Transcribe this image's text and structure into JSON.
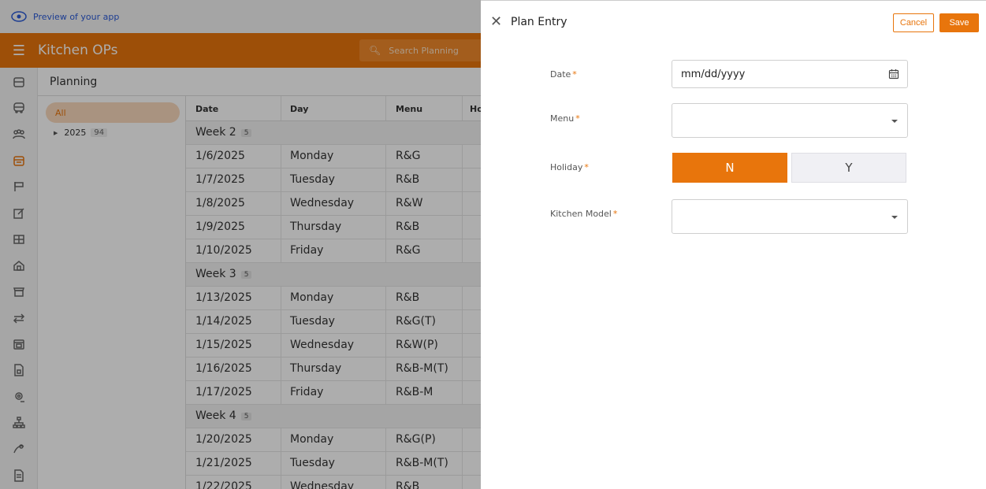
{
  "preview": {
    "text": "Preview of your app"
  },
  "header": {
    "title": "Kitchen OPs",
    "search_placeholder": "Search Planning"
  },
  "rail": {
    "icons": [
      "building-icon",
      "bus-icon",
      "users-icon",
      "calendar-icon",
      "sign-icon",
      "edit-icon",
      "table-icon",
      "home-icon",
      "store-icon",
      "transfer-icon",
      "calendar-alt-icon",
      "document-icon",
      "location-icon",
      "org-chart-icon",
      "settings-icon",
      "file-icon"
    ]
  },
  "page": {
    "title": "Planning"
  },
  "tree": {
    "all_label": "All",
    "year": "2025",
    "year_count": "94"
  },
  "grid": {
    "columns": [
      "Date",
      "Day",
      "Menu",
      "Ho"
    ],
    "rows": [
      {
        "type": "week",
        "label": "Week 2",
        "count": "5"
      },
      {
        "date": "1/6/2025",
        "day": "Monday",
        "menu": "R&G"
      },
      {
        "date": "1/7/2025",
        "day": "Tuesday",
        "menu": "R&B"
      },
      {
        "date": "1/8/2025",
        "day": "Wednesday",
        "menu": "R&W"
      },
      {
        "date": "1/9/2025",
        "day": "Thursday",
        "menu": "R&B"
      },
      {
        "date": "1/10/2025",
        "day": "Friday",
        "menu": "R&G"
      },
      {
        "type": "week",
        "label": "Week 3",
        "count": "5"
      },
      {
        "date": "1/13/2025",
        "day": "Monday",
        "menu": "R&B"
      },
      {
        "date": "1/14/2025",
        "day": "Tuesday",
        "menu": "R&G(T)"
      },
      {
        "date": "1/15/2025",
        "day": "Wednesday",
        "menu": "R&W(P)"
      },
      {
        "date": "1/16/2025",
        "day": "Thursday",
        "menu": "R&B-M(T)"
      },
      {
        "date": "1/17/2025",
        "day": "Friday",
        "menu": "R&B-M"
      },
      {
        "type": "week",
        "label": "Week 4",
        "count": "5"
      },
      {
        "date": "1/20/2025",
        "day": "Monday",
        "menu": "R&G(P)"
      },
      {
        "date": "1/21/2025",
        "day": "Tuesday",
        "menu": "R&B-M(T)"
      },
      {
        "date": "1/22/2025",
        "day": "Wednesday",
        "menu": "R&B"
      }
    ]
  },
  "drawer": {
    "title": "Plan Entry",
    "cancel_label": "Cancel",
    "save_label": "Save",
    "fields": {
      "date_label": "Date",
      "date_placeholder": "mm/dd/yyyy",
      "menu_label": "Menu",
      "holiday_label": "Holiday",
      "holiday_n": "N",
      "holiday_y": "Y",
      "kitchen_model_label": "Kitchen Model",
      "required_mark": "*"
    }
  },
  "colors": {
    "accent": "#e8750c",
    "link": "#2b5bd7"
  }
}
